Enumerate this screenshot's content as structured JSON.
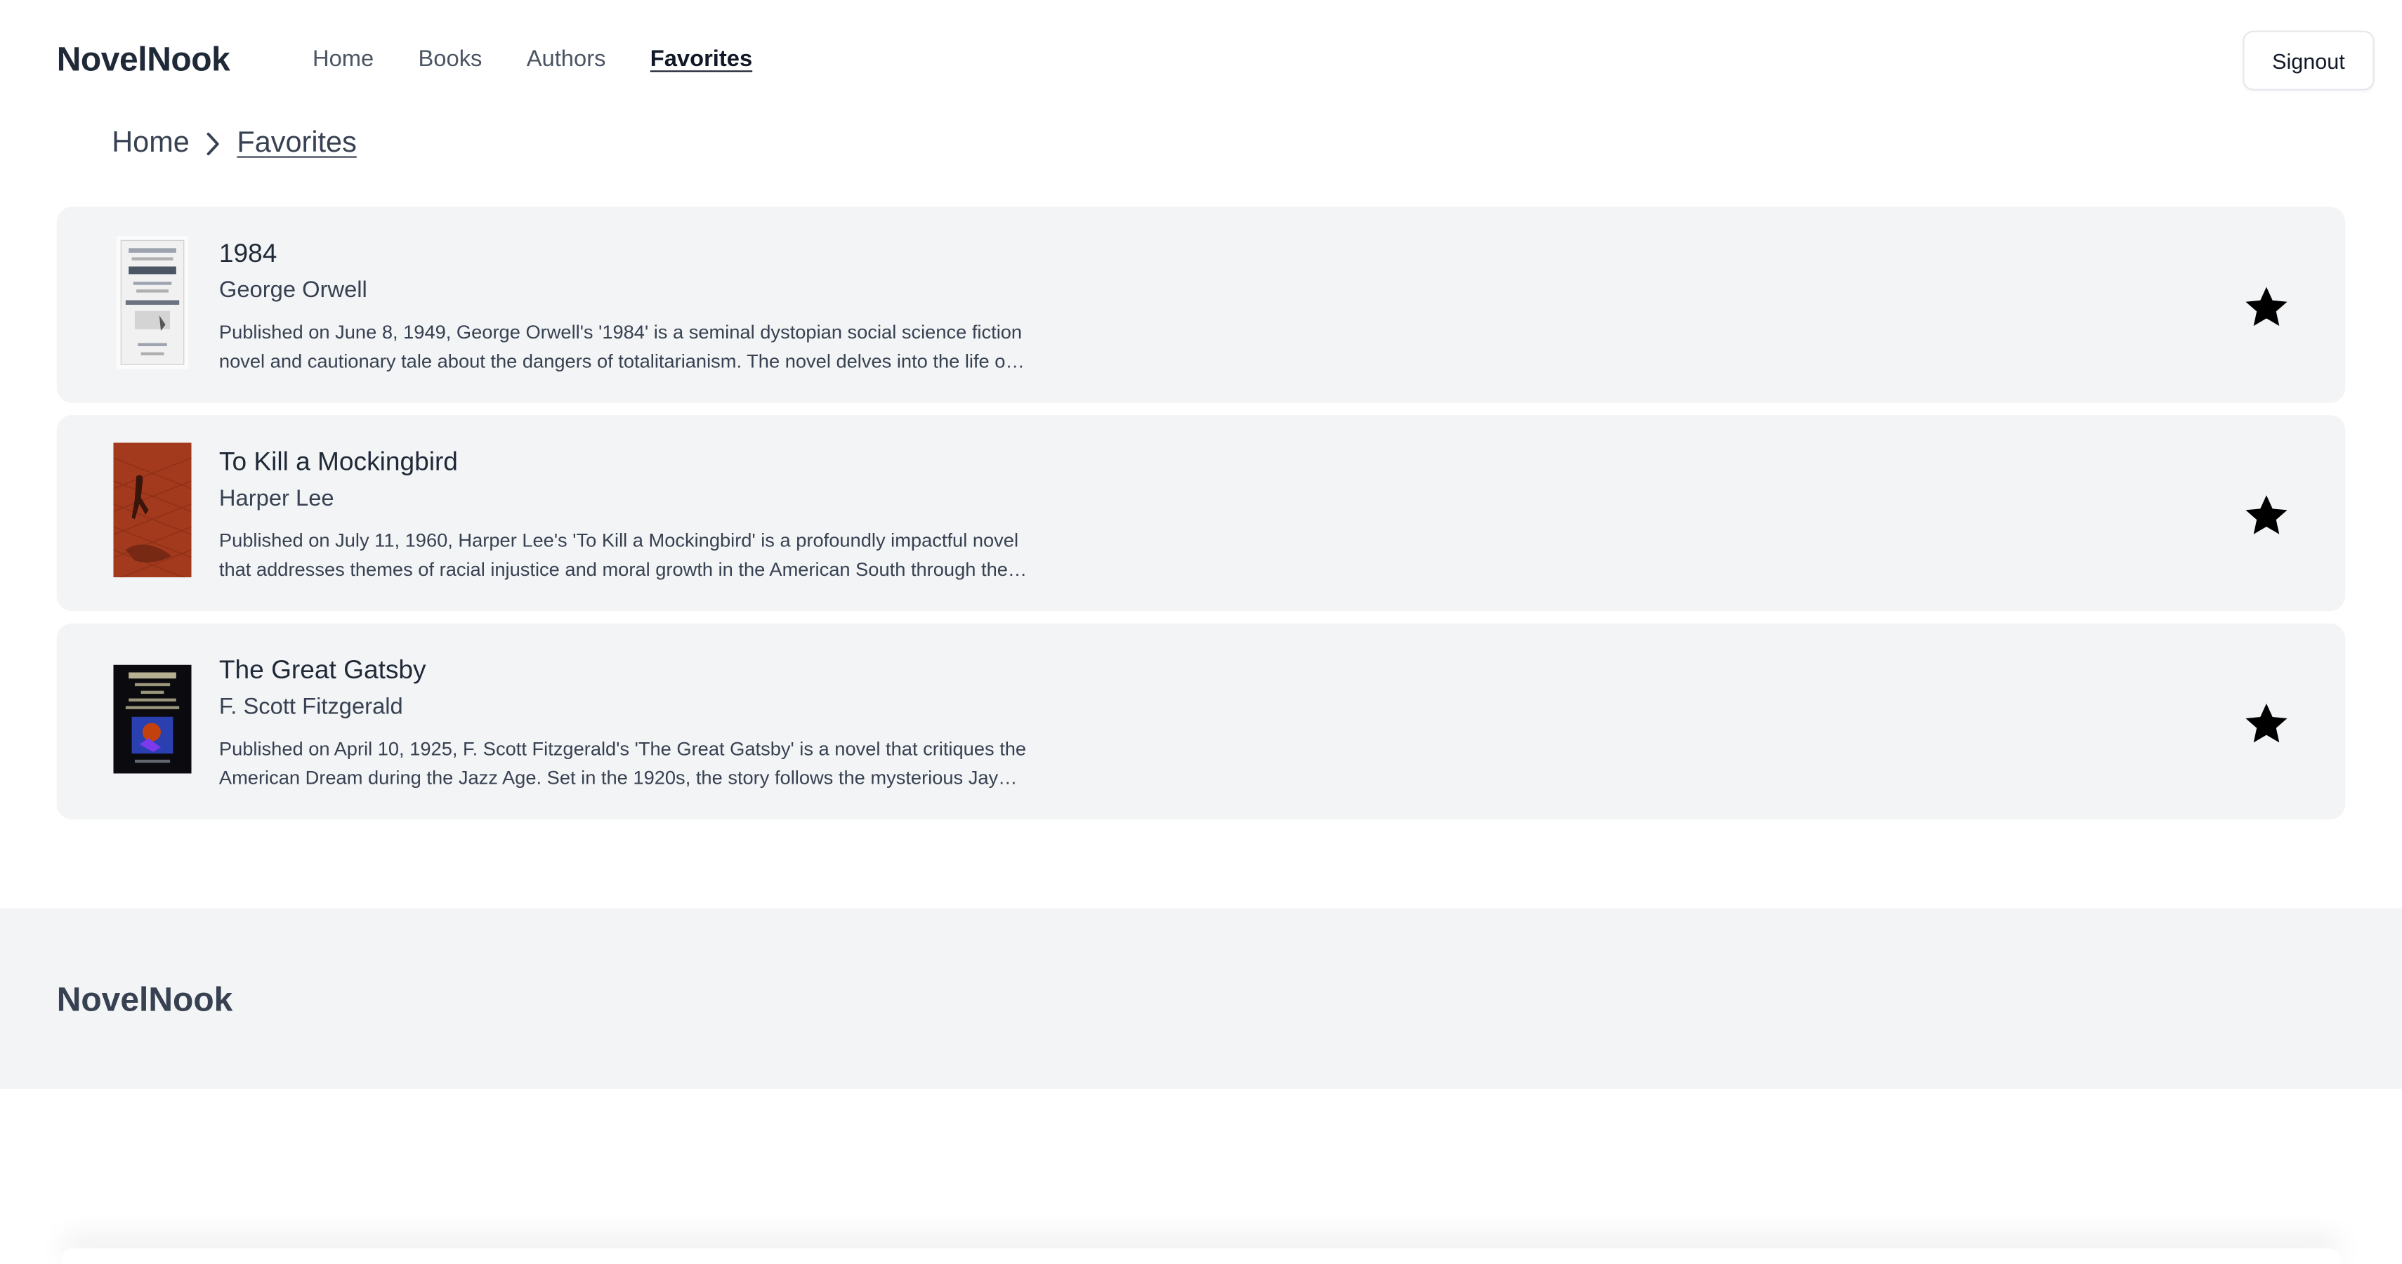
{
  "header": {
    "brand": "NovelNook",
    "nav": [
      {
        "label": "Home"
      },
      {
        "label": "Books"
      },
      {
        "label": "Authors"
      },
      {
        "label": "Favorites",
        "active": true
      }
    ],
    "signout_label": "Signout"
  },
  "breadcrumb": {
    "home": "Home",
    "current": "Favorites"
  },
  "favorites": [
    {
      "title": "1984",
      "author": "George Orwell",
      "description": "Published on June 8, 1949, George Orwell's '1984' is a seminal dystopian social science fiction novel and cautionary tale about the dangers of totalitarianism. The novel delves into the life of Winston Smith",
      "favorited": true
    },
    {
      "title": "To Kill a Mockingbird",
      "author": "Harper Lee",
      "description": "Published on July 11, 1960, Harper Lee's 'To Kill a Mockingbird' is a profoundly impactful novel that addresses themes of racial injustice and moral growth in the American South through the eyes of Scout Finch",
      "favorited": true
    },
    {
      "title": "The Great Gatsby",
      "author": "F. Scott Fitzgerald",
      "description": "Published on April 10, 1925, F. Scott Fitzgerald's 'The Great Gatsby' is a novel that critiques the American Dream during the Jazz Age. Set in the 1920s, the story follows the mysterious Jay Gatsby",
      "favorited": true
    }
  ],
  "footer": {
    "brand": "NovelNook"
  },
  "colors": {
    "card_bg": "#f3f4f6",
    "text": "#374151",
    "star": "#000000"
  }
}
